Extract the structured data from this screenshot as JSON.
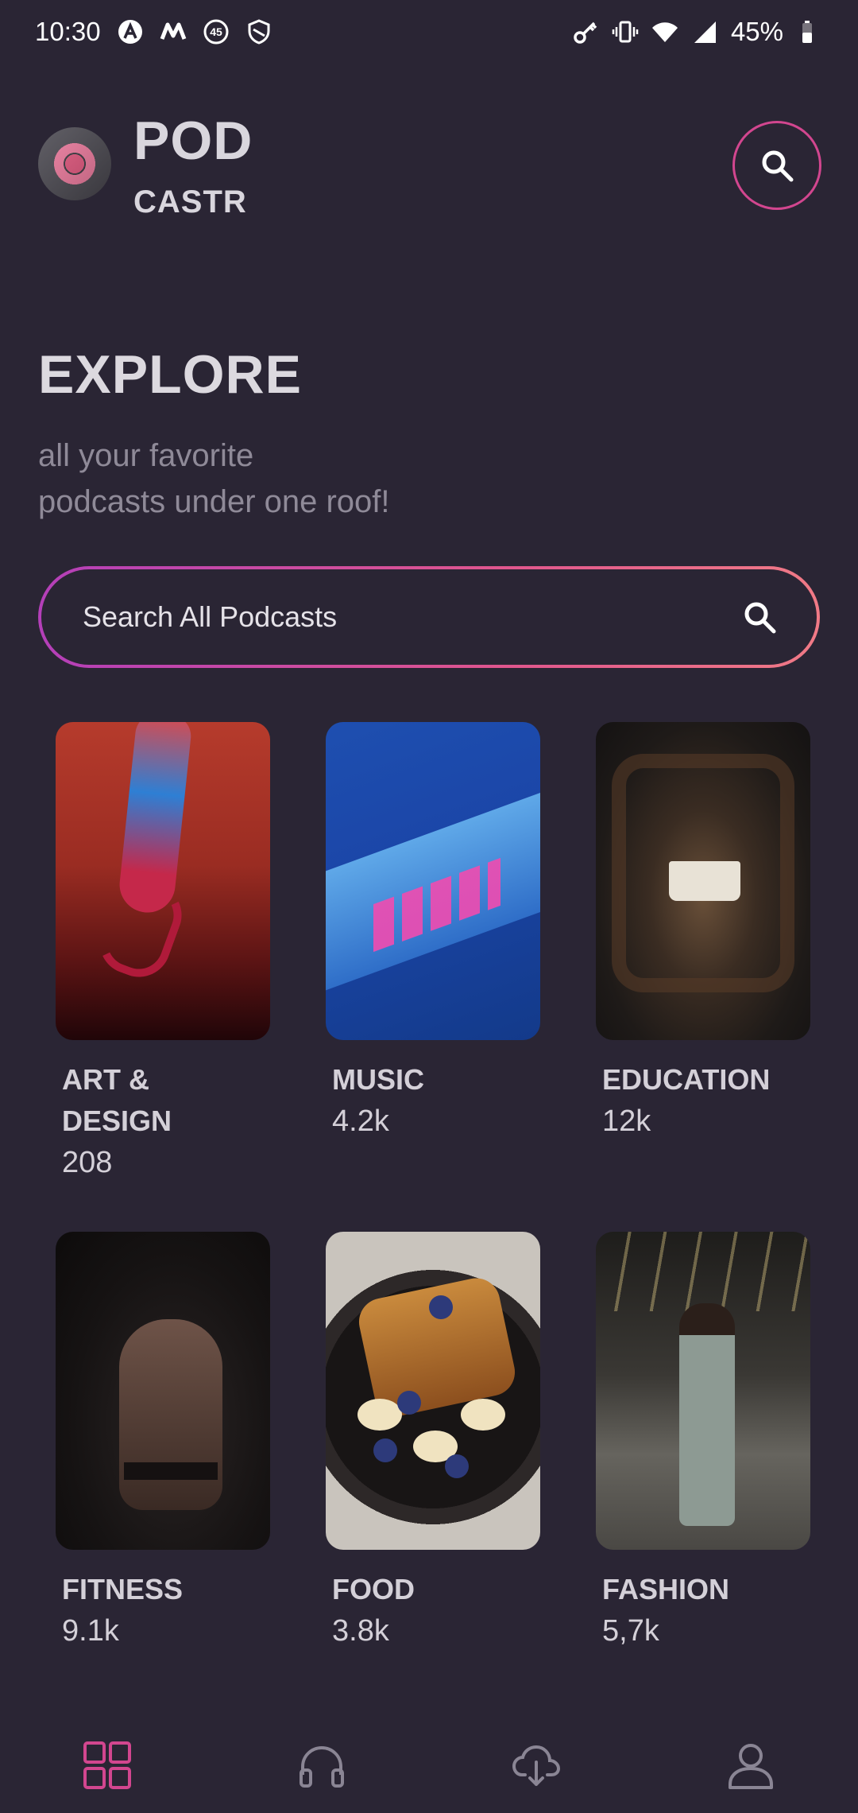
{
  "status_bar": {
    "time": "10:30",
    "notification_icons": [
      "a-icon",
      "m-icon",
      "45-badge-icon",
      "shield-icon"
    ],
    "badge_number": "45",
    "right_icons": [
      "key-icon",
      "vibrate-icon",
      "wifi-icon",
      "signal-icon",
      "battery-icon"
    ],
    "battery_percent": "45%"
  },
  "header": {
    "brand_top": "POD",
    "brand_bottom": "CASTR",
    "accent_color": "#d2468f"
  },
  "explore": {
    "title": "EXPLORE",
    "subtitle_line1": "all your favorite",
    "subtitle_line2": "podcasts under one roof!"
  },
  "search": {
    "placeholder": "Search All Podcasts"
  },
  "categories": [
    {
      "title_line1": "ART &",
      "title_line2": "DESIGN",
      "count": "208"
    },
    {
      "title_line1": "MUSIC",
      "title_line2": "",
      "count": "4.2k"
    },
    {
      "title_line1": "EDUCATION",
      "title_line2": "",
      "count": "12k"
    },
    {
      "title_line1": "FITNESS",
      "title_line2": "",
      "count": "9.1k"
    },
    {
      "title_line1": "FOOD",
      "title_line2": "",
      "count": "3.8k"
    },
    {
      "title_line1": "FASHION",
      "title_line2": "",
      "count": "5,7k"
    }
  ],
  "bottom_nav": {
    "items": [
      "explore-grid-icon",
      "headphones-icon",
      "cloud-download-icon",
      "profile-icon"
    ],
    "active_index": 0,
    "active_color": "#d2468f",
    "inactive_color": "#8a8594"
  }
}
